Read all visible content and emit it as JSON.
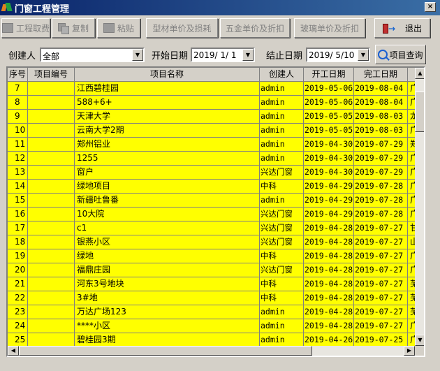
{
  "window": {
    "title": "门窗工程管理",
    "close_label": "×"
  },
  "toolbar": {
    "buttons": [
      {
        "label": "工程取费",
        "enabled": false
      },
      {
        "label": "复制",
        "enabled": false
      },
      {
        "label": "粘贴",
        "enabled": false
      },
      {
        "label": "型材单价及损耗",
        "enabled": false
      },
      {
        "label": "五金单价及折扣",
        "enabled": false
      },
      {
        "label": "玻璃单价及折扣",
        "enabled": false
      },
      {
        "label": "退出",
        "enabled": true
      }
    ]
  },
  "filters": {
    "creator_label": "创建人",
    "creator_value": "全部",
    "start_label": "开始日期",
    "start_value": "2019/ 1/ 1",
    "end_label": "结止日期",
    "end_value": "2019/ 5/10",
    "query_label": "项目查询"
  },
  "table": {
    "columns": [
      "序号",
      "项目编号",
      "项目名称",
      "创建人",
      "开工日期",
      "完工日期",
      ""
    ],
    "rows": [
      [
        "7",
        "",
        "江西碧桂园",
        "admin",
        "2019-05-06",
        "2019-08-04",
        "广"
      ],
      [
        "8",
        "",
        "588+6+",
        "admin",
        "2019-05-06",
        "2019-08-04",
        "广"
      ],
      [
        "9",
        "",
        "天津大学",
        "admin",
        "2019-05-05",
        "2019-08-03",
        "龙"
      ],
      [
        "10",
        "",
        "云南大学2期",
        "admin",
        "2019-05-05",
        "2019-08-03",
        "广"
      ],
      [
        "11",
        "",
        "郑州铝业",
        "admin",
        "2019-04-30",
        "2019-07-29",
        "郑"
      ],
      [
        "12",
        "",
        "1255",
        "admin",
        "2019-04-30",
        "2019-07-29",
        "广"
      ],
      [
        "13",
        "",
        "窗户",
        "兴达门窗",
        "2019-04-30",
        "2019-07-29",
        "广"
      ],
      [
        "14",
        "",
        "绿地项目",
        "中科",
        "2019-04-29",
        "2019-07-28",
        "广"
      ],
      [
        "15",
        "",
        "新疆吐鲁番",
        "admin",
        "2019-04-29",
        "2019-07-28",
        "广"
      ],
      [
        "16",
        "",
        "10大院",
        "兴达门窗",
        "2019-04-29",
        "2019-07-28",
        "广"
      ],
      [
        "17",
        "",
        "c1",
        "兴达门窗",
        "2019-04-28",
        "2019-07-27",
        "甘"
      ],
      [
        "18",
        "",
        "银燕小区",
        "兴达门窗",
        "2019-04-28",
        "2019-07-27",
        "山"
      ],
      [
        "19",
        "",
        "绿地",
        "中科",
        "2019-04-28",
        "2019-07-27",
        "广"
      ],
      [
        "20",
        "",
        "福鼎庄园",
        "兴达门窗",
        "2019-04-28",
        "2019-07-27",
        "广"
      ],
      [
        "21",
        "",
        "河东3号地块",
        "中科",
        "2019-04-28",
        "2019-07-27",
        "芜"
      ],
      [
        "22",
        "",
        "3#地",
        "中科",
        "2019-04-28",
        "2019-07-27",
        "芜"
      ],
      [
        "23",
        "",
        "万达广场123",
        "admin",
        "2019-04-28",
        "2019-07-27",
        "芜"
      ],
      [
        "24",
        "",
        "****小区",
        "admin",
        "2019-04-28",
        "2019-07-27",
        "广"
      ],
      [
        "25",
        "",
        "碧桂园3期",
        "admin",
        "2019-04-26",
        "2019-07-25",
        "广"
      ]
    ]
  },
  "colors": {
    "row_bg": "#ffff00",
    "title_bar": "#0a246a",
    "face": "#d4d0c8"
  }
}
